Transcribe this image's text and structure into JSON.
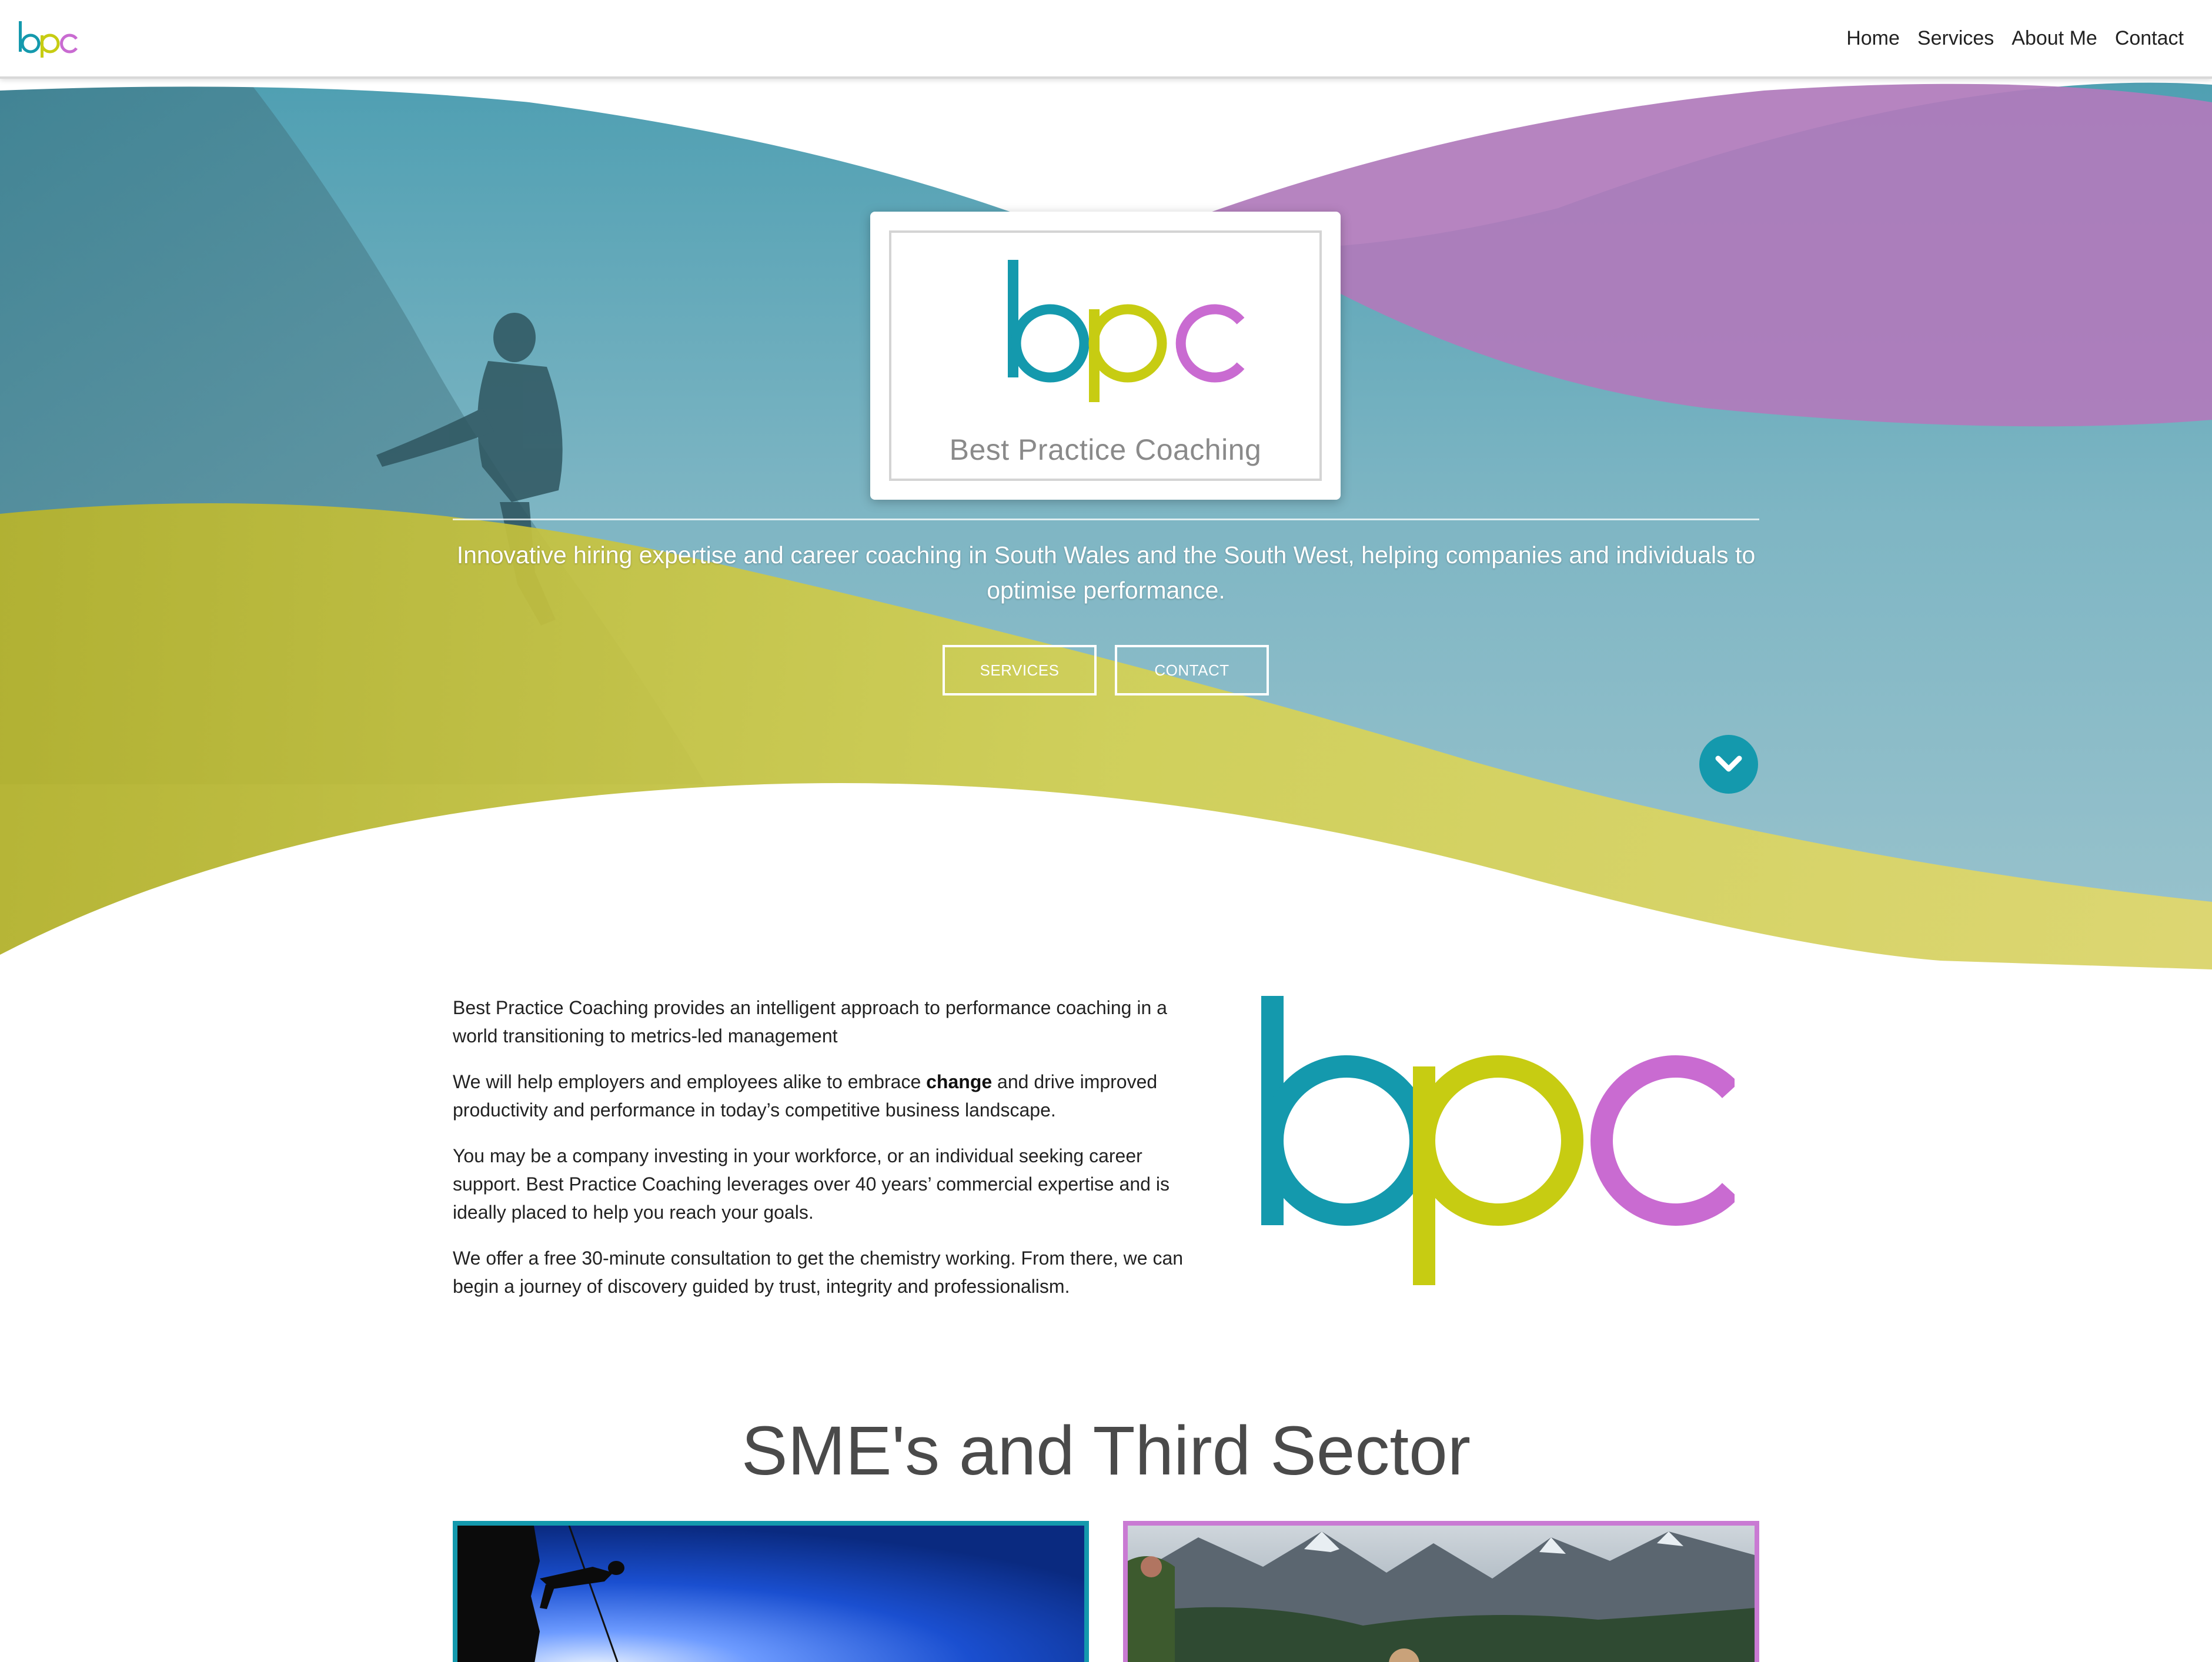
{
  "nav": {
    "logo_text": "bpc",
    "links": [
      "Home",
      "Services",
      "About Me",
      "Contact"
    ]
  },
  "hero": {
    "logo_text": "bpc",
    "brand_name": "Best Practice Coaching",
    "tagline": "Innovative hiring expertise and career coaching in South Wales and the South West, helping companies and individuals to optimise performance.",
    "buttons": {
      "services": "SERVICES",
      "contact": "CONTACT"
    },
    "scroll_icon": "chevron-down-icon"
  },
  "intro": {
    "p1": "Best Practice Coaching provides an intelligent approach to performance coaching in a world transitioning to metrics-led management",
    "p2_before": "We will help employers and employees alike to embrace ",
    "p2_bold": "change",
    "p2_after": " and drive improved productivity and performance in today’s competitive business landscape.",
    "p3": "You may be a company investing in your workforce, or an individual seeking career support. Best Practice Coaching leverages over 40 years’ commercial expertise and is ideally placed to help you reach your goals.",
    "p4": "We offer a free 30-minute consultation to get the chemistry working. From there, we can begin a journey of discovery guided by trust, integrity and professionalism."
  },
  "section": {
    "title": "SME's and Third Sector"
  },
  "colors": {
    "teal": "#1499ad",
    "lime": "#c7cc12",
    "magenta": "#c96bd1",
    "hero_teal": "#5fa9b8",
    "hero_purple": "#b07bbb",
    "hero_yellow": "#c9c84a"
  }
}
